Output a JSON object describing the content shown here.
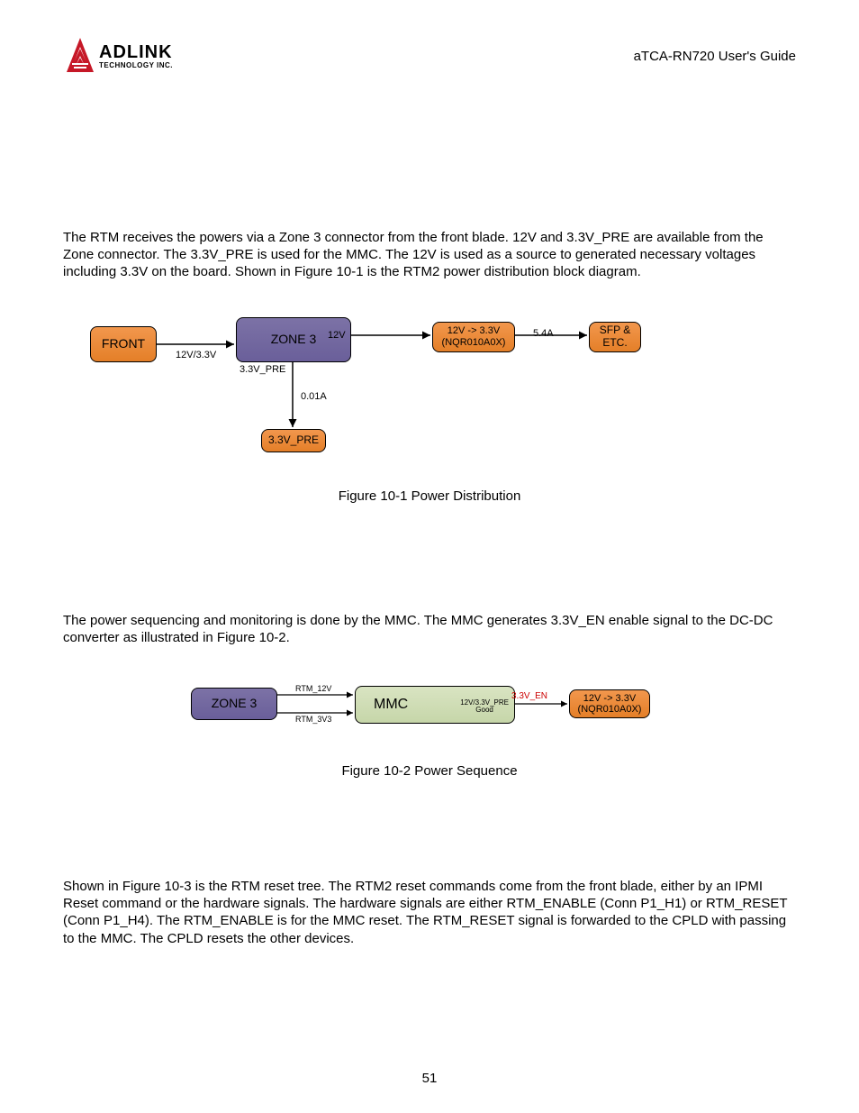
{
  "header": {
    "title": "aTCA-RN720 User's Guide",
    "logo_main": "ADLINK",
    "logo_sub": "TECHNOLOGY INC."
  },
  "para1": "The RTM receives the powers via a Zone 3 connector from the front blade. 12V and 3.3V_PRE are available from the Zone connector. The 3.3V_PRE is used for the MMC. The 12V is used as a source to generated necessary voltages including 3.3V on the board. Shown in Figure 10-1 is the RTM2 power distribution block diagram.",
  "fig1": {
    "front": "FRONT",
    "zone3": "ZONE 3",
    "conv": "12V -> 3.3V\n(NQR010A0X)",
    "sfp": "SFP &\nETC.",
    "pre": "3.3V_PRE",
    "l_12v33": "12V/3.3V",
    "l_12v": "12V",
    "l_33vpre": "3.3V_PRE",
    "l_001a": "0.01A",
    "l_54a": "5.4A",
    "caption": "Figure 10-1 Power Distribution"
  },
  "para2": "The power sequencing and monitoring is done by the MMC. The MMC generates 3.3V_EN enable signal to the DC-DC converter as illustrated in Figure 10-2.",
  "fig2": {
    "zone3": "ZONE 3",
    "mmc": "MMC",
    "mmc_sub": "12V/3.3V_PRE\nGood",
    "conv": "12V -> 3.3V\n(NQR010A0X)",
    "l_rtm12v": "RTM_12V",
    "l_rtm3v3": "RTM_3V3",
    "l_33ven": "3.3V_EN",
    "caption": "Figure 10-2 Power Sequence"
  },
  "para3": "Shown in Figure 10-3 is the RTM reset tree. The RTM2 reset commands come from the front blade, either by an IPMI Reset command or the hardware signals. The hardware signals are either RTM_ENABLE (Conn P1_H1) or RTM_RESET (Conn P1_H4). The RTM_ENABLE is for the MMC reset. The RTM_RESET signal is forwarded to the CPLD with passing to the MMC. The CPLD resets the other devices.",
  "page_number": "51"
}
